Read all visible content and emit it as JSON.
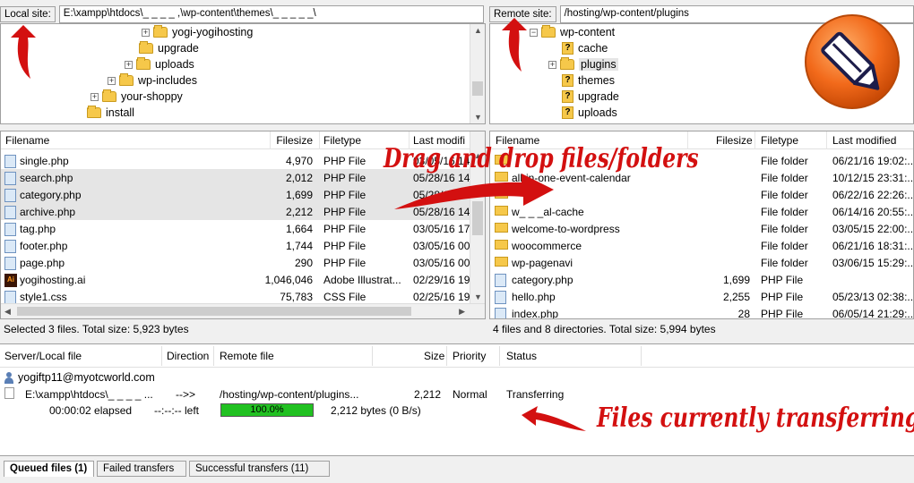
{
  "local_site": {
    "label": "Local site:",
    "path": "E:\\xampp\\htdocs\\_ _ _ _ ,\\wp-content\\themes\\_ _ _ _ _\\",
    "tree": [
      {
        "name": "yogi-yogihosting",
        "expandable": true
      },
      {
        "name": "upgrade",
        "expandable": false
      },
      {
        "name": "uploads",
        "expandable": true
      },
      {
        "name": "wp-includes",
        "expandable": true
      },
      {
        "name": "your-shoppy",
        "expandable": true
      },
      {
        "name": "install",
        "expandable": false
      }
    ]
  },
  "remote_site": {
    "label": "Remote site:",
    "path": "/hosting/wp-content/plugins",
    "tree": [
      {
        "name": "wp-content",
        "type": "open"
      },
      {
        "name": "cache",
        "type": "unknown"
      },
      {
        "name": "plugins",
        "type": "expand"
      },
      {
        "name": "themes",
        "type": "unknown"
      },
      {
        "name": "upgrade",
        "type": "unknown"
      },
      {
        "name": "uploads",
        "type": "unknown"
      }
    ]
  },
  "local_files": {
    "columns": [
      "Filename",
      "Filesize",
      "Filetype",
      "Last modifi"
    ],
    "rows": [
      {
        "name": "single.php",
        "size": "4,970",
        "type": "PHP File",
        "date": "03/05/16 14",
        "selected": false,
        "icon": "php-file-icon"
      },
      {
        "name": "search.php",
        "size": "2,012",
        "type": "PHP File",
        "date": "05/28/16 14",
        "selected": true,
        "icon": "php-file-icon"
      },
      {
        "name": "category.php",
        "size": "1,699",
        "type": "PHP File",
        "date": "05/28/16 14",
        "selected": true,
        "icon": "php-file-icon"
      },
      {
        "name": "archive.php",
        "size": "2,212",
        "type": "PHP File",
        "date": "05/28/16 14",
        "selected": true,
        "icon": "php-file-icon"
      },
      {
        "name": "tag.php",
        "size": "1,664",
        "type": "PHP File",
        "date": "03/05/16 17",
        "selected": false,
        "icon": "php-file-icon"
      },
      {
        "name": "footer.php",
        "size": "1,744",
        "type": "PHP File",
        "date": "03/05/16 00",
        "selected": false,
        "icon": "php-file-icon"
      },
      {
        "name": "page.php",
        "size": "290",
        "type": "PHP File",
        "date": "03/05/16 00",
        "selected": false,
        "icon": "php-file-icon"
      },
      {
        "name": "yogihosting.ai",
        "size": "1,046,046",
        "type": "Adobe Illustrat...",
        "date": "02/29/16 19",
        "selected": false,
        "icon": "illustrator-file-icon"
      },
      {
        "name": "style1.css",
        "size": "75,783",
        "type": "CSS File",
        "date": "02/25/16 19",
        "selected": false,
        "icon": "css-file-icon"
      }
    ],
    "status": "Selected 3 files. Total size: 5,923 bytes"
  },
  "remote_files": {
    "columns": [
      "Filename",
      "Filesize",
      "Filetype",
      "Last modified"
    ],
    "rows": [
      {
        "name": "",
        "size": "",
        "type": "File folder",
        "date": "06/21/16 19:02:...",
        "folder": true
      },
      {
        "name": "all-in-one-event-calendar",
        "size": "",
        "type": "File folder",
        "date": "10/12/15 23:31:...",
        "folder": true
      },
      {
        "name": "",
        "size": "",
        "type": "File folder",
        "date": "06/22/16 22:26:...",
        "folder": true
      },
      {
        "name": "w_ _ _al-cache",
        "size": "",
        "type": "File folder",
        "date": "06/14/16 20:55:...",
        "folder": true
      },
      {
        "name": "welcome-to-wordpress",
        "size": "",
        "type": "File folder",
        "date": "03/05/15 22:00:...",
        "folder": true
      },
      {
        "name": "woocommerce",
        "size": "",
        "type": "File folder",
        "date": "06/21/16 18:31:...",
        "folder": true
      },
      {
        "name": "wp-pagenavi",
        "size": "",
        "type": "File folder",
        "date": "03/06/15 15:29:...",
        "folder": true
      },
      {
        "name": "category.php",
        "size": "1,699",
        "type": "PHP File",
        "date": "",
        "folder": false
      },
      {
        "name": "hello.php",
        "size": "2,255",
        "type": "PHP File",
        "date": "05/23/13 02:38:...",
        "folder": false
      },
      {
        "name": "index.php",
        "size": "28",
        "type": "PHP File",
        "date": "06/05/14 21:29:...",
        "folder": false
      }
    ],
    "status": "4 files and 8 directories. Total size: 5,994 bytes"
  },
  "queue": {
    "columns": [
      "Server/Local file",
      "Direction",
      "Remote file",
      "Size",
      "Priority",
      "Status"
    ],
    "server": "yogiftp11@myotcworld.com",
    "item": {
      "local": "E:\\xampp\\htdocs\\_ _ _ _ ...",
      "direction": "-->>",
      "remote": "/hosting/wp-content/plugins...",
      "size": "2,212",
      "priority": "Normal",
      "status": "Transferring"
    },
    "progress": {
      "elapsed": "00:00:02 elapsed",
      "left": "--:--:-- left",
      "percent_label": "100.0%",
      "fraction": 1.0,
      "bytes": "2,212 bytes (0 B/s)"
    }
  },
  "tabs": [
    {
      "label": "Queued files (1)",
      "active": true
    },
    {
      "label": "Failed transfers",
      "active": false
    },
    {
      "label": "Successful transfers (11)",
      "active": false
    }
  ],
  "annotations": {
    "drag": "Drag and drop files/folders",
    "transfer": "Files currently transferring"
  },
  "colors": {
    "annotation": "#d31010",
    "progress": "#21c121",
    "selection": "#e5e5e5",
    "logo_orange": "#f26a1b"
  }
}
